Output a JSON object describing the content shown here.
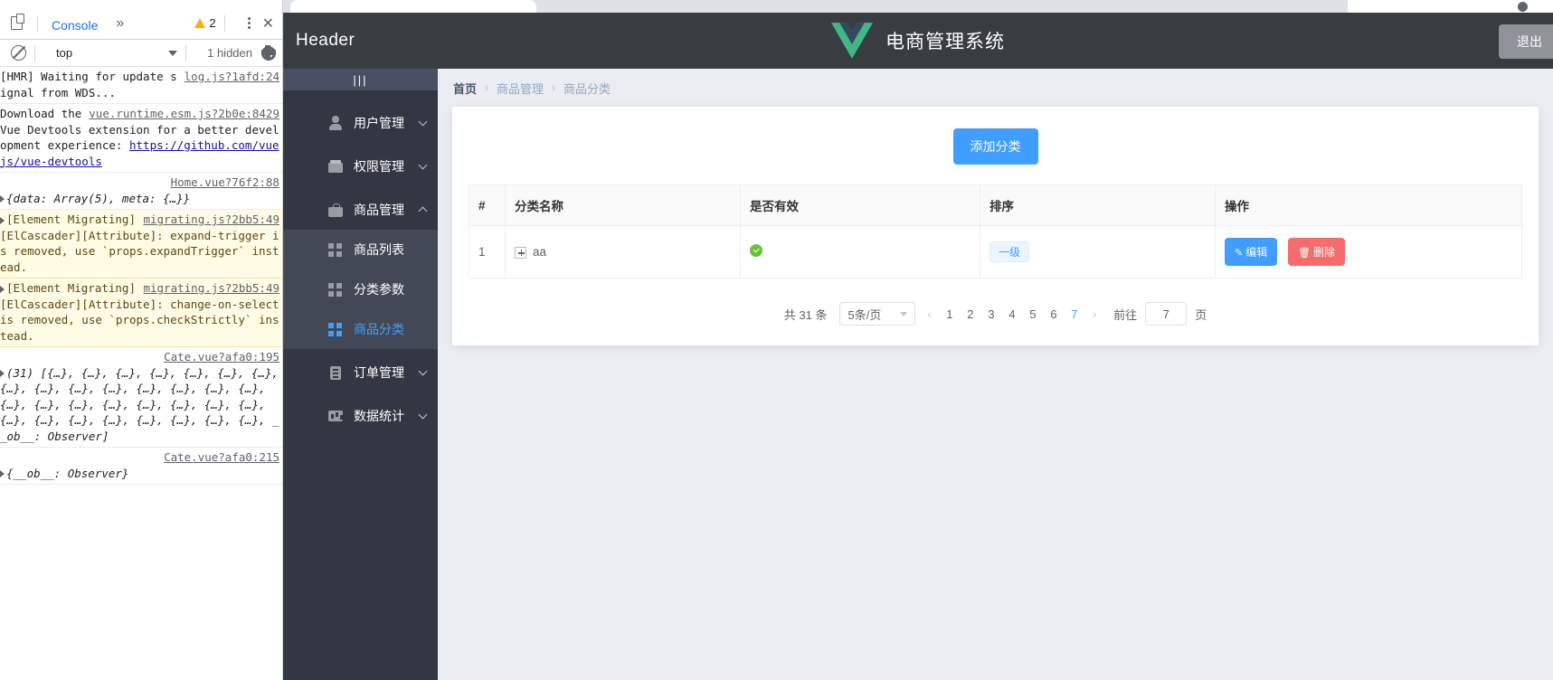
{
  "devtools": {
    "dock_icon": "dock-panel-icon",
    "tab_label": "Console",
    "more_tabs": "»",
    "warning_count": "2",
    "close_label": "✕",
    "context_value": "top",
    "hidden_label": "1 hidden",
    "settings_icon": "gear-icon",
    "logs": [
      {
        "type": "info",
        "text": "[HMR] Waiting for update signal from WDS...",
        "source": "log.js?1afd:24"
      },
      {
        "type": "info",
        "text_pre": "Download ",
        "text_mid": "the Vue Devtools extension for a better development experience:",
        "link": "https://github.com/vuejs/vue-devtools",
        "source": "vue.runtime.esm.js?2b0e:8429"
      },
      {
        "type": "object",
        "text": "{data: Array(5), meta: {…}}",
        "source": "Home.vue?76f2:88"
      },
      {
        "type": "warn",
        "text": "[Element Migrating][ElCascader][Attribute]: expand-trigger is removed, use `props.expandTrigger` instead.",
        "source": "migrating.js?2bb5:49"
      },
      {
        "type": "warn",
        "text": "[Element Migrating][ElCascader][Attribute]: change-on-select is removed, use `props.checkStrictly` instead.",
        "source": "migrating.js?2bb5:49"
      },
      {
        "type": "object",
        "text": "(31) [{…}, {…}, {…}, {…}, {…}, {…}, {…}, {…}, {…}, {…}, {…}, {…}, {…}, {…}, {…}, {…}, {…}, {…}, {…}, {…}, {…}, {…}, {…}, {…}, {…}, {…}, {…}, {…}, {…}, {…}, {…}, __ob__: Observer]",
        "source": "Cate.vue?afa0:195"
      },
      {
        "type": "object",
        "text": "{__ob__: Observer}",
        "source": "Cate.vue?afa0:215"
      }
    ]
  },
  "app": {
    "header": {
      "left_label": "Header",
      "logo_icon": "vue-logo-icon",
      "title": "电商管理系统",
      "logout_label": "退出"
    },
    "sidebar": {
      "collapse_toggle": "|||",
      "items": [
        {
          "label": "用户管理",
          "icon": "user-icon",
          "expanded": false
        },
        {
          "label": "权限管理",
          "icon": "box-icon",
          "expanded": false
        },
        {
          "label": "商品管理",
          "icon": "bag-icon",
          "expanded": true
        },
        {
          "label": "商品列表",
          "icon": "grid-icon",
          "child": true
        },
        {
          "label": "分类参数",
          "icon": "grid-icon",
          "child": true
        },
        {
          "label": "商品分类",
          "icon": "grid-icon",
          "child": true,
          "active": true
        },
        {
          "label": "订单管理",
          "icon": "clipboard-icon",
          "expanded": false
        },
        {
          "label": "数据统计",
          "icon": "chart-icon",
          "expanded": false
        }
      ]
    },
    "breadcrumb": [
      "首页",
      "商品管理",
      "商品分类"
    ],
    "breadcrumb_separator": "›",
    "add_button_label": "添加分类",
    "table": {
      "columns": [
        "#",
        "分类名称",
        "是否有效",
        "排序",
        "操作"
      ],
      "rows": [
        {
          "index": "1",
          "name": "aa",
          "expand_icon": "expand-plus-icon",
          "valid_icon": "check-circle-icon",
          "level_tag": "一级",
          "edit_label": "编辑",
          "delete_label": "删除",
          "edit_icon": "pencil-icon",
          "delete_icon": "trash-icon"
        }
      ]
    },
    "pagination": {
      "total_label": "共 31 条",
      "page_size_label": "5条/页",
      "prev_icon": "‹",
      "next_icon": "›",
      "pages": [
        "1",
        "2",
        "3",
        "4",
        "5",
        "6",
        "7"
      ],
      "current_page": "7",
      "jump_prefix": "前往",
      "jump_value": "7",
      "jump_suffix": "页"
    }
  },
  "colors": {
    "primary": "#409eff",
    "danger": "#f56c6c",
    "success": "#67c23a",
    "header_bg": "#373d41",
    "sidebar_bg": "#333744",
    "sidebar_sub_bg": "#434857",
    "page_bg": "#eaedf1"
  }
}
